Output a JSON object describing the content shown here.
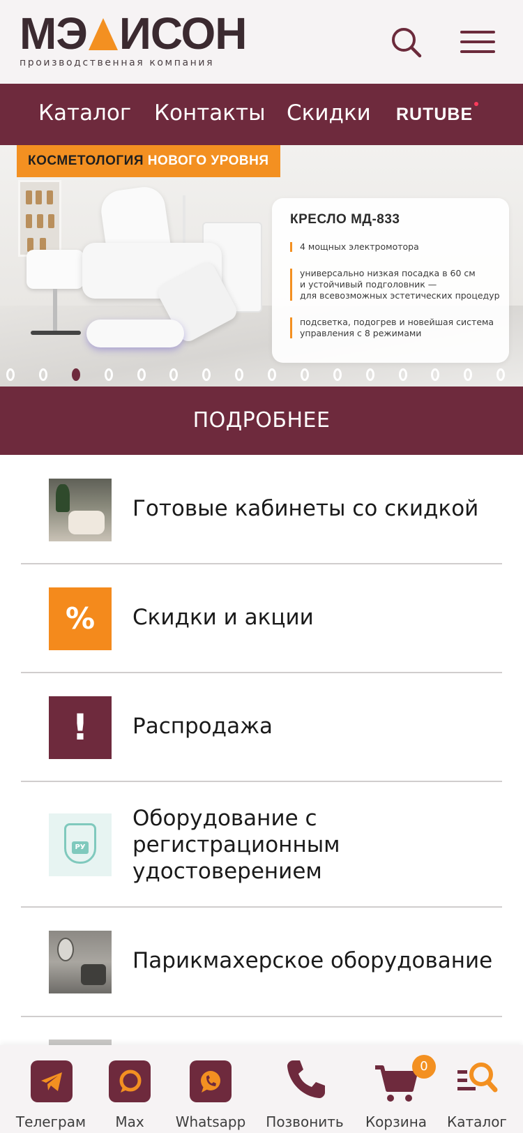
{
  "header": {
    "logo_text_left": "МЭ",
    "logo_text_right": "ИСОН",
    "logo_subtitle": "производственная компания",
    "search_icon": "search-icon",
    "menu_icon": "hamburger-menu-icon"
  },
  "nav": {
    "items": [
      "Каталог",
      "Контакты",
      "Скидки"
    ],
    "rutube_label": "RUTUBE"
  },
  "banner": {
    "tag_dark": "КОСМЕТОЛОГИЯ",
    "tag_light": "НОВОГО УРОВНЯ",
    "card_title": "КРЕСЛО МД-833",
    "features": [
      "4 мощных электромотора",
      "универсально низкая посадка в 60 см\nи устойчивый подголовник —\nдля всевозможных эстетических процедур",
      "подсветка, подогрев и новейшая система\nуправления с 8 режимами"
    ],
    "slide_count": 16,
    "active_slide": 3
  },
  "more_button": "ПОДРОБНЕЕ",
  "categories": [
    {
      "label": "Готовые кабинеты со скидкой",
      "icon": "cabinet-photo"
    },
    {
      "label": "Скидки и акции",
      "icon": "percent-icon",
      "symbol": "%"
    },
    {
      "label": "Распродажа",
      "icon": "exclamation-icon",
      "symbol": "!"
    },
    {
      "label": "Оборудование с\nрегистрационным\nудостоверением",
      "icon": "registration-emblem-icon",
      "emblem_text": "РУ"
    },
    {
      "label": "Парикмахерское оборудование",
      "icon": "hairdresser-photo"
    }
  ],
  "bottom_bar": {
    "items": [
      {
        "label": "Телеграм",
        "icon": "telegram-icon"
      },
      {
        "label": "Max",
        "icon": "max-chat-icon"
      },
      {
        "label": "Whatsapp",
        "icon": "whatsapp-icon"
      },
      {
        "label": "Позвонить",
        "icon": "phone-icon"
      },
      {
        "label": "Корзина",
        "icon": "cart-icon"
      },
      {
        "label": "Каталог",
        "icon": "catalog-search-icon"
      }
    ],
    "cart_count": "0"
  },
  "colors": {
    "brand_burgundy": "#6e2a3d",
    "accent_orange": "#f39021",
    "logo_dark": "#3b2a30"
  }
}
